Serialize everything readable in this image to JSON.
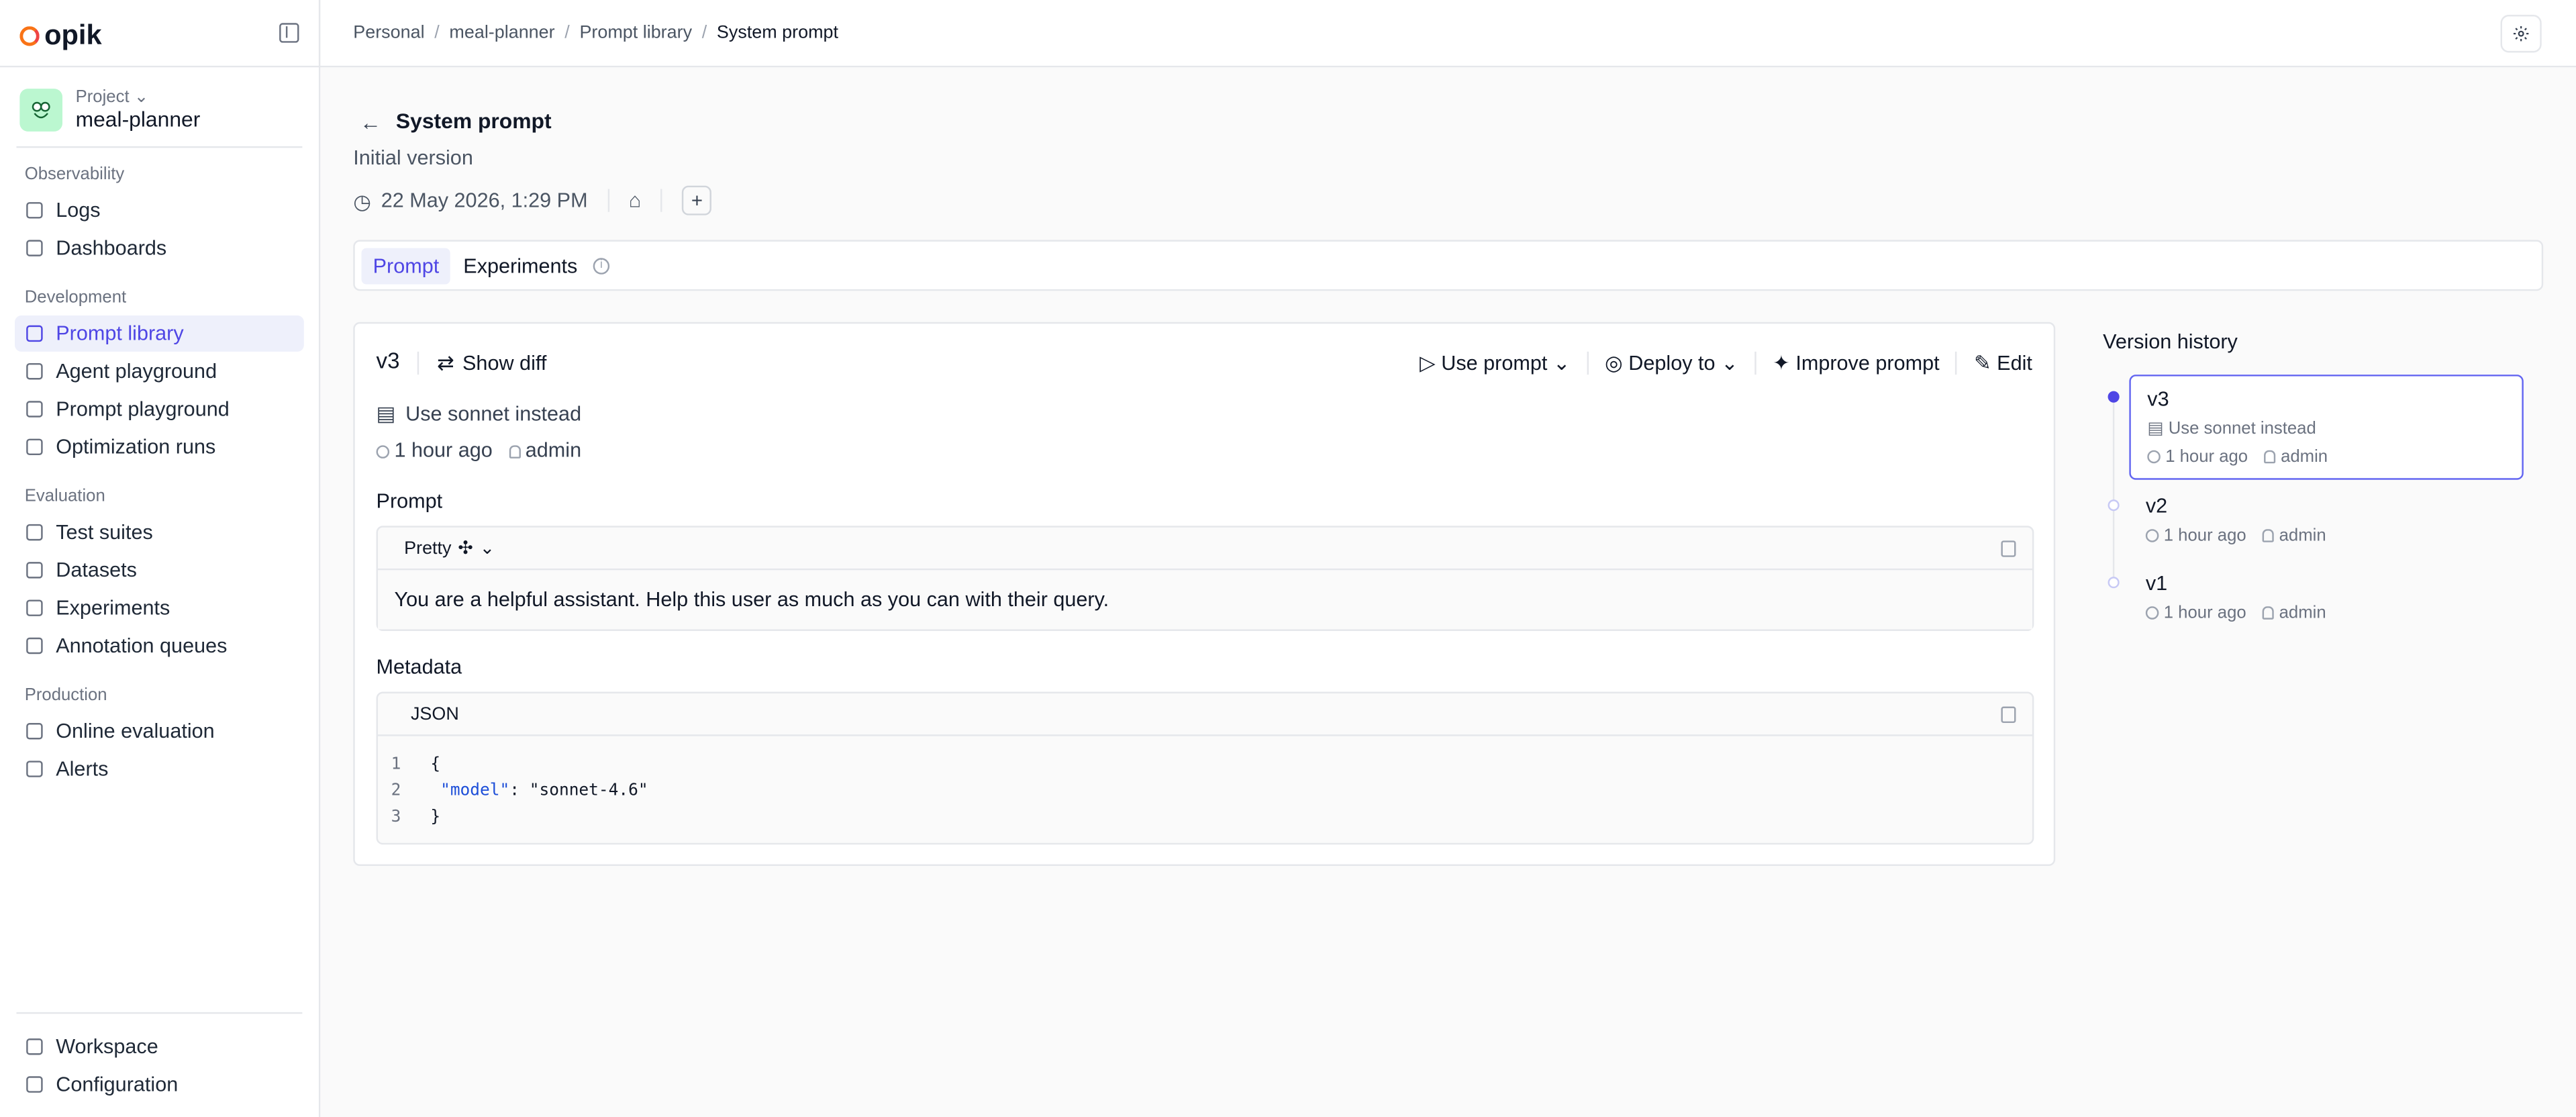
{
  "app": {
    "name": "opik"
  },
  "breadcrumb": [
    "Personal",
    "meal-planner",
    "Prompt library",
    "System prompt"
  ],
  "sidebar": {
    "project_label": "Project",
    "project_name": "meal-planner",
    "sections": [
      {
        "title": "Observability",
        "items": [
          {
            "label": "Logs",
            "icon": "logs-icon"
          },
          {
            "label": "Dashboards",
            "icon": "chart-icon"
          }
        ]
      },
      {
        "title": "Development",
        "items": [
          {
            "label": "Prompt library",
            "icon": "file-icon",
            "active": true
          },
          {
            "label": "Agent playground",
            "icon": "branch-icon"
          },
          {
            "label": "Prompt playground",
            "icon": "blocks-icon"
          },
          {
            "label": "Optimization runs",
            "icon": "sparkle-icon"
          }
        ]
      },
      {
        "title": "Evaluation",
        "items": [
          {
            "label": "Test suites",
            "icon": "list-check-icon"
          },
          {
            "label": "Datasets",
            "icon": "database-icon"
          },
          {
            "label": "Experiments",
            "icon": "flask-icon"
          },
          {
            "label": "Annotation queues",
            "icon": "users-icon"
          }
        ]
      },
      {
        "title": "Production",
        "items": [
          {
            "label": "Online evaluation",
            "icon": "globe-icon"
          },
          {
            "label": "Alerts",
            "icon": "bell-icon"
          }
        ]
      }
    ],
    "footer": [
      {
        "label": "Workspace",
        "icon": "grid-icon"
      },
      {
        "label": "Configuration",
        "icon": "sliders-icon"
      }
    ]
  },
  "page": {
    "title": "System prompt",
    "subtitle": "Initial version",
    "timestamp": "22 May 2026, 1:29 PM",
    "add_tag_label": "+"
  },
  "tabs": [
    {
      "label": "Prompt",
      "active": true
    },
    {
      "label": "Experiments"
    }
  ],
  "version_card": {
    "version": "v3",
    "show_diff": "Show diff",
    "actions": {
      "use_prompt": "Use prompt",
      "deploy_to": "Deploy to",
      "improve_prompt": "Improve prompt",
      "edit": "Edit"
    },
    "commit_message": "Use sonnet instead",
    "time": "1 hour ago",
    "author": "admin",
    "prompt_title": "Prompt",
    "prompt_view": "Pretty",
    "prompt_text": "You are a helpful assistant. Help this user as much as you can with their query.",
    "metadata_title": "Metadata",
    "metadata_view": "JSON",
    "json_lines": [
      {
        "n": "1",
        "text": "{"
      },
      {
        "n": "2",
        "key": "\"model\"",
        "rest": ": \"sonnet-4.6\""
      },
      {
        "n": "3",
        "text": "}"
      }
    ]
  },
  "version_history": {
    "title": "Version history",
    "items": [
      {
        "version": "v3",
        "message": "Use sonnet instead",
        "time": "1 hour ago",
        "author": "admin",
        "active": true
      },
      {
        "version": "v2",
        "time": "1 hour ago",
        "author": "admin"
      },
      {
        "version": "v1",
        "time": "1 hour ago",
        "author": "admin"
      }
    ]
  },
  "colors": {
    "accent": "#4f46e5",
    "active_bg": "#eef0fb",
    "border": "#e5e7eb"
  }
}
